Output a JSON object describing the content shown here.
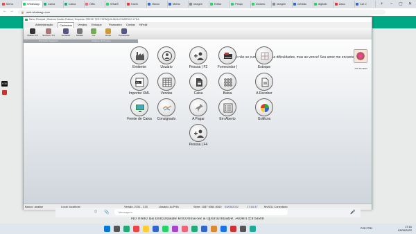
{
  "browser": {
    "tabs": [
      "Menu",
      "WhatsApp",
      "Caixa",
      "Caixa",
      "Offic",
      "WhatS",
      "Kavin",
      "Havoc",
      "Melho",
      "imagen",
      "Editor",
      "Pesqu",
      "Downlo",
      "imagen",
      "Gestão",
      "digitaln",
      "Assu",
      "Cal C"
    ],
    "url": "web.whatsapp.com",
    "tab_colors": [
      "#e44",
      "#25d366",
      "#2a7",
      "#2a7",
      "#e67",
      "#25d366",
      "#e33",
      "#36c",
      "#36c",
      "#888",
      "#25d366",
      "#25d366",
      "#25d366",
      "#888",
      "#36c",
      "#25d366",
      "#e33",
      "#36c"
    ]
  },
  "erp": {
    "title": "Menu Principal | Sistema Gestão Prática | Empresa: PRECE TER FORNQUILINHA COMERCIO LTDA",
    "menus": [
      "Administração",
      "Cadastros",
      "Vendas",
      "Estoque",
      "Financeiro",
      "Contas",
      "NFe@"
    ],
    "toolbar": [
      {
        "label": "Cliente / F2",
        "color": "#333"
      },
      {
        "label": "Serviços / F3",
        "color": "#a77"
      },
      {
        "label": "Vendedor",
        "color": "#558"
      },
      {
        "label": "Modelo",
        "color": "#777"
      },
      {
        "label": "Cor",
        "color": "#7a5"
      },
      {
        "label": "Grupo",
        "color": "#c93"
      },
      {
        "label": "Fornecedor",
        "color": "#558"
      }
    ],
    "groups": [
      "Principais Cadastros",
      "Cadastro de Produto"
    ],
    "motto": "Mãe, você não se curva diante das dificuldades, mas as vence! Seu amor me encanta!",
    "logo_label": "Dia das Mães",
    "buttons": [
      {
        "label": "Emitente",
        "icon": "factory-icon"
      },
      {
        "label": "Usuário",
        "icon": "user-check-icon"
      },
      {
        "label": "Pessoa | F2",
        "icon": "add-person-icon"
      },
      {
        "label": "Fornecedor |",
        "icon": "supplier-icon"
      },
      {
        "label": "Estoque",
        "icon": "boxes-icon"
      },
      {
        "label": "Importar XML",
        "icon": "xml-icon"
      },
      {
        "label": "Vendas",
        "icon": "spreadsheet-icon"
      },
      {
        "label": "Caixa",
        "icon": "document-icon"
      },
      {
        "label": "Baixa",
        "icon": "grid-dots-icon"
      },
      {
        "label": "A Receber",
        "icon": "receipt-icon"
      },
      {
        "label": "Frente de Caixa",
        "icon": "monitor-icon"
      },
      {
        "label": "Consignado",
        "icon": "handshake-icon"
      },
      {
        "label": "A Pagar",
        "icon": "pushpin-icon"
      },
      {
        "label": "Em Aberto",
        "icon": "checklist-icon"
      },
      {
        "label": "Gráficos",
        "icon": "pie-chart-icon"
      },
      {
        "label": "Pessoa | F4",
        "icon": "add-person-icon"
      }
    ],
    "quote": "No meio da dificuldade encontra-se a oportunidade. Albert Einstein",
    "status": {
      "bank": "Banco: analise",
      "local": "Local: localhost",
      "version": "Versão: 2151 - 215",
      "user": "Usuário: ALPHA",
      "serial": "Série: 1087 9364 8160",
      "date": "03/05/2022",
      "time": "17:15:37",
      "db": "MySQL Conectado"
    }
  },
  "whatsapp": {
    "placeholder": "Mensagem"
  },
  "taskbar": {
    "time": "17:16",
    "date": "03/05/2022",
    "lang": "POR PTB2"
  },
  "side": {
    "timer": "6:30"
  }
}
